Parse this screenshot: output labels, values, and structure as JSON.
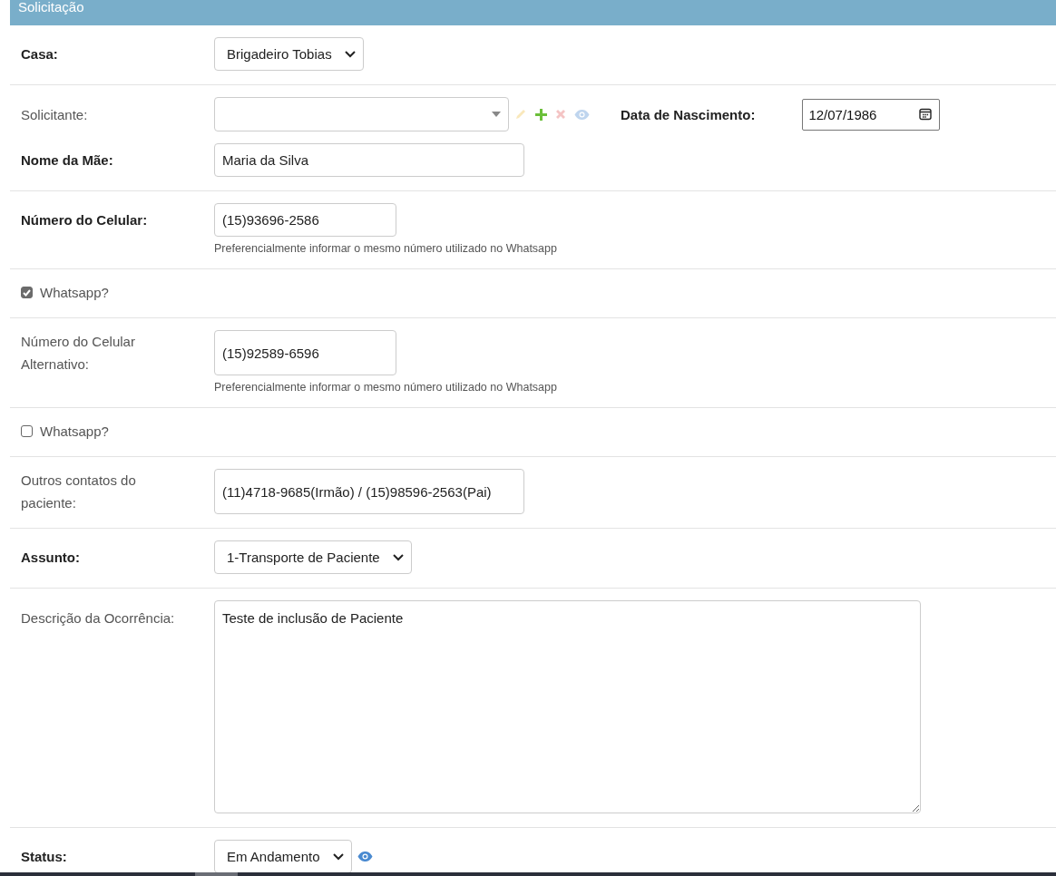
{
  "header": {
    "title": "Solicitação"
  },
  "rows": [
    {
      "lines": [
        [
          {
            "kind": "select",
            "label": "Casa:",
            "required": true,
            "value": "Brigadeiro Tobias"
          }
        ]
      ]
    },
    {
      "lines": [
        [
          {
            "kind": "lookup",
            "label": "Solicitante:",
            "required": false,
            "actions": [
              {
                "kind": "edit",
                "disabled": true
              },
              {
                "kind": "add",
                "disabled": false
              },
              {
                "kind": "delete",
                "disabled": true
              },
              {
                "kind": "view",
                "disabled": true
              }
            ]
          },
          {
            "kind": "date",
            "label": "Data de Nascimento:",
            "required": true,
            "value": "12/07/1986"
          }
        ],
        [
          {
            "kind": "text",
            "label": "Nome da Mãe:",
            "required": true,
            "value": "Maria da Silva"
          }
        ]
      ]
    },
    {
      "lines": [
        [
          {
            "kind": "text",
            "label": "Número do Celular:",
            "required": true,
            "value": "(15)93696-2586",
            "help": "Preferencialmente informar o mesmo número utilizado no Whatsapp"
          }
        ]
      ]
    },
    {
      "lines": [
        [
          {
            "kind": "checkbox",
            "label": "Whatsapp?",
            "checked": true
          }
        ]
      ]
    },
    {
      "lines": [
        [
          {
            "kind": "text",
            "label": "Número do Celular Alternativo:",
            "required": false,
            "value": "(15)92589-6596",
            "help": "Preferencialmente informar o mesmo número utilizado no Whatsapp"
          }
        ]
      ]
    },
    {
      "lines": [
        [
          {
            "kind": "checkbox",
            "label": "Whatsapp?",
            "checked": false
          }
        ]
      ]
    },
    {
      "lines": [
        [
          {
            "kind": "text",
            "label": "Outros contatos do paciente:",
            "required": false,
            "value": "(11)4718-9685(Irmão) / (15)98596-2563(Pai)"
          }
        ]
      ]
    },
    {
      "lines": [
        [
          {
            "kind": "select",
            "label": "Assunto:",
            "required": true,
            "value": "1-Transporte de Paciente"
          }
        ]
      ]
    },
    {
      "lines": [
        [
          {
            "kind": "textarea",
            "label": "Descrição da Ocorrência:",
            "required": false,
            "value": "Teste de inclusão de Paciente"
          }
        ]
      ]
    },
    {
      "lines": [
        [
          {
            "kind": "select",
            "label": "Status:",
            "required": true,
            "value": "Em Andamento",
            "actions": [
              {
                "kind": "view",
                "disabled": false
              }
            ]
          }
        ]
      ]
    }
  ]
}
